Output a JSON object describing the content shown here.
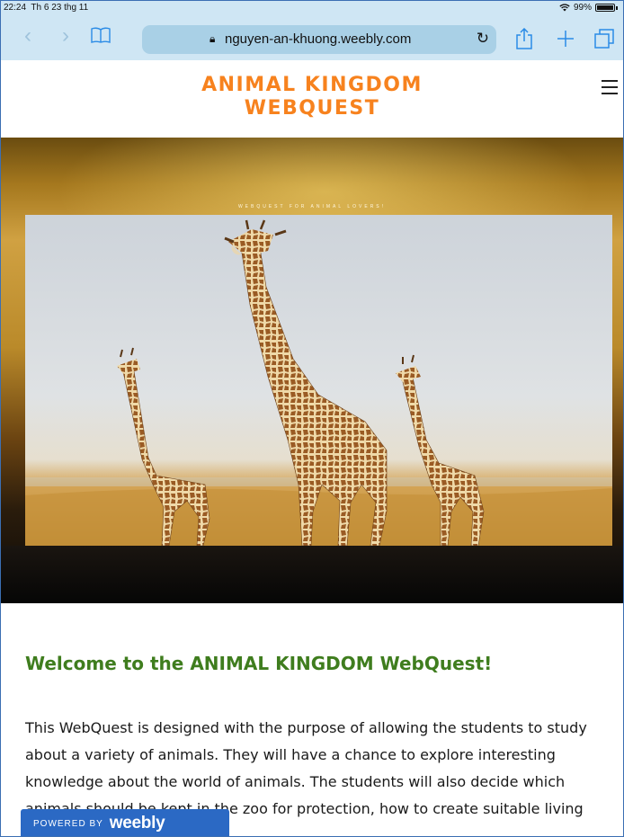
{
  "status_bar": {
    "time": "22:24",
    "date": "Th 6 23 thg 11",
    "battery": "99%"
  },
  "browser": {
    "url": "nguyen-an-khuong.weebly.com",
    "accent_color": "#2a8be6"
  },
  "site": {
    "title_line1": "ANIMAL KINGDOM",
    "title_line2": "WEBQUEST",
    "title_color": "#f7821e"
  },
  "hero": {
    "tagline": "WEBQUEST FOR ANIMAL LOVERS!"
  },
  "content": {
    "heading": "Welcome to the ANIMAL KINGDOM WebQuest!",
    "heading_color": "#3f7d1e",
    "paragraph": "This WebQuest is designed with the purpose of allowing the students to study about a variety of animals. They will have a chance to explore interesting knowledge about the world of animals. The students will also decide which animals should be kept in the zoo for protection, how to create suitable living conditions for them."
  },
  "badge": {
    "powered_by": "POWERED BY",
    "brand": "weebly",
    "color": "#2b69c4"
  }
}
